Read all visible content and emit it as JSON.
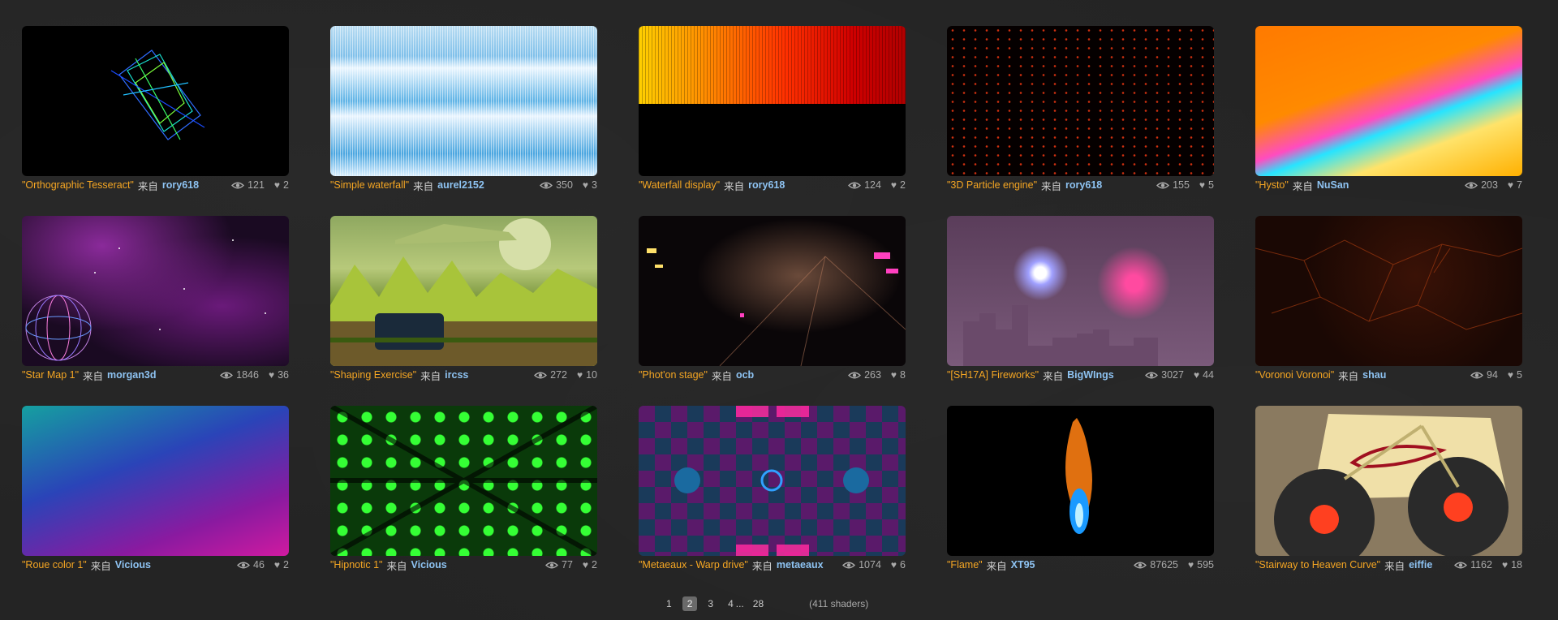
{
  "shaders": [
    {
      "title": "\"Orthographic Tesseract\"",
      "from": "来自",
      "author": "rory618",
      "views": "121",
      "likes": "2",
      "thumb": "tesseract"
    },
    {
      "title": "\"Simple waterfall\"",
      "from": "来自",
      "author": "aurel2152",
      "views": "350",
      "likes": "3",
      "thumb": "waterfall"
    },
    {
      "title": "\"Waterfall display\"",
      "from": "来自",
      "author": "rory618",
      "views": "124",
      "likes": "2",
      "thumb": "waterfall2"
    },
    {
      "title": "\"3D Particle engine\"",
      "from": "来自",
      "author": "rory618",
      "views": "155",
      "likes": "5",
      "thumb": "particles"
    },
    {
      "title": "\"Hysto\"",
      "from": "来自",
      "author": "NuSan",
      "views": "203",
      "likes": "7",
      "thumb": "hysto"
    },
    {
      "title": "\"Star Map 1\"",
      "from": "来自",
      "author": "morgan3d",
      "views": "1846",
      "likes": "36",
      "thumb": "starmap"
    },
    {
      "title": "\"Shaping Exercise\"",
      "from": "来自",
      "author": "ircss",
      "views": "272",
      "likes": "10",
      "thumb": "shaping"
    },
    {
      "title": "\"Phot'on stage\"",
      "from": "来自",
      "author": "ocb",
      "views": "263",
      "likes": "8",
      "thumb": "photon"
    },
    {
      "title": "\"[SH17A] Fireworks\"",
      "from": "来自",
      "author": "BigWIngs",
      "views": "3027",
      "likes": "44",
      "thumb": "fireworks"
    },
    {
      "title": "\"Voronoi Voronoi\"",
      "from": "来自",
      "author": "shau",
      "views": "94",
      "likes": "5",
      "thumb": "voronoi"
    },
    {
      "title": "\"Roue color 1\"",
      "from": "来自",
      "author": "Vicious",
      "views": "46",
      "likes": "2",
      "thumb": "roue"
    },
    {
      "title": "\"Hipnotic 1\"",
      "from": "来自",
      "author": "Vicious",
      "views": "77",
      "likes": "2",
      "thumb": "hipnotic"
    },
    {
      "title": "\"Metaeaux - Warp drive\"",
      "from": "来自",
      "author": "metaeaux",
      "views": "1074",
      "likes": "6",
      "thumb": "metaeaux"
    },
    {
      "title": "\"Flame\"",
      "from": "来自",
      "author": "XT95",
      "views": "87625",
      "likes": "595",
      "thumb": "flame"
    },
    {
      "title": "\"Stairway to Heaven Curve\"",
      "from": "来自",
      "author": "eiffie",
      "views": "1162",
      "likes": "18",
      "thumb": "stairway"
    }
  ],
  "pagination": {
    "pages": [
      "1",
      "2",
      "3",
      "4"
    ],
    "current": "2",
    "ellipsis": "...",
    "last": "28",
    "count_text": "(411 shaders)"
  },
  "icons": {
    "views": "eye-icon",
    "likes": "heart-icon"
  },
  "colors": {
    "title": "#f5a623",
    "author": "#8ec3f2",
    "background": "#242424"
  }
}
